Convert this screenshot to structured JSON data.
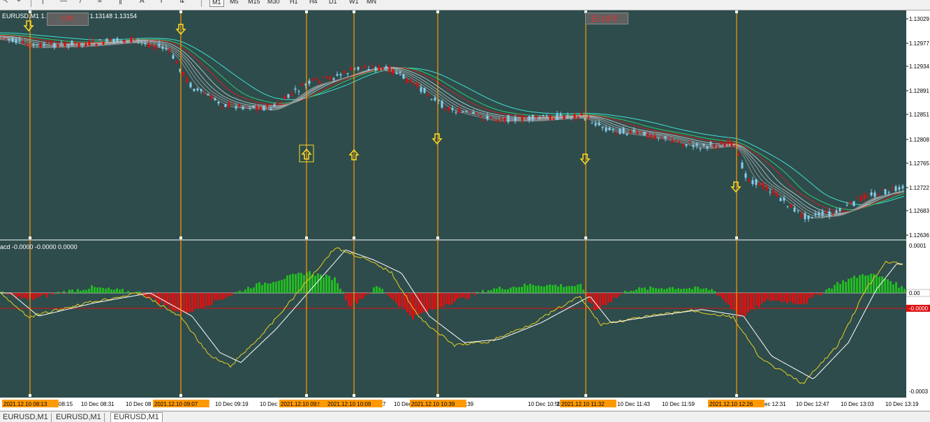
{
  "window": {
    "symbol_label": "EURUSD,M1  1.13150 1.13154 1.13148 1.13154",
    "macd_label": "acd -0.0000 -0.0000 0.0000",
    "buttons": {
      "on": "ON",
      "ei": "EI OFF"
    }
  },
  "toolbar": {
    "timeframes": [
      "M1",
      "M5",
      "M15",
      "M30",
      "H1",
      "H4",
      "D1",
      "W1",
      "MN"
    ],
    "active_timeframe": "M1",
    "icons": [
      "cursor-icon",
      "crosshair-icon",
      "vertical-line-icon",
      "horizontal-line-icon",
      "trendline-icon",
      "fibonacci-icon",
      "channel-icon",
      "text-icon",
      "label-icon",
      "arrows-icon"
    ]
  },
  "colors": {
    "chart_bg": "#2e4c4c",
    "bull_candle": "#87ceeb",
    "bear_candle": "#d01010",
    "vline": "#ff9900",
    "hist_pos": "#22bb22",
    "hist_neg": "#dd1111",
    "signal_arrow": "#ffdd22"
  },
  "price_axis": {
    "labels": [
      "1.13029",
      "1.12977",
      "1.12934",
      "1.12891",
      "1.12851",
      "1.12808",
      "1.12765",
      "1.12722",
      "1.12683",
      "1.12636"
    ]
  },
  "macd_axis": {
    "labels": [
      "0.0001",
      "0.00",
      "-0.0000",
      "-0.0003"
    ]
  },
  "time_axis": {
    "labels": [
      {
        "text": "2021.12.10 08:13",
        "hl": true
      },
      {
        "text": "08:15",
        "hl": false
      },
      {
        "text": "10 Dec 08:31",
        "hl": false
      },
      {
        "text": "10 Dec 08",
        "hl": false
      },
      {
        "text": "2021.12.10 09:07",
        "hl": true
      },
      {
        "text": "10 Dec 09:19",
        "hl": false
      },
      {
        "text": "10 Dec",
        "hl": false
      },
      {
        "text": "2021.12.10 09:!",
        "hl": true
      },
      {
        "text": "2021.12.10 10:09",
        "hl": true
      },
      {
        "text": "7",
        "hl": false
      },
      {
        "text": "10 Dec",
        "hl": false
      },
      {
        "text": "2021.12.10 10:39",
        "hl": true
      },
      {
        "text": ":39",
        "hl": false
      },
      {
        "text": "10 Dec 10:55",
        "hl": false
      },
      {
        "text": "10 Dec 11:",
        "hl": false
      },
      {
        "text": "2021.12.10 11:32",
        "hl": true
      },
      {
        "text": "10 Dec 11:43",
        "hl": false
      },
      {
        "text": "10 Dec 11:59",
        "hl": false
      },
      {
        "text": "2021.12.10 12:26",
        "hl": true
      },
      {
        "text": "ec 12:31",
        "hl": false
      },
      {
        "text": "10 Dec 12:47",
        "hl": false
      },
      {
        "text": "10 Dec 13:03",
        "hl": false
      },
      {
        "text": "10 Dec 13:19",
        "hl": false
      }
    ]
  },
  "tabs": [
    "EURUSD,M1",
    "EURUSD,M1",
    "EURUSD,M1"
  ],
  "active_tab": 2
}
